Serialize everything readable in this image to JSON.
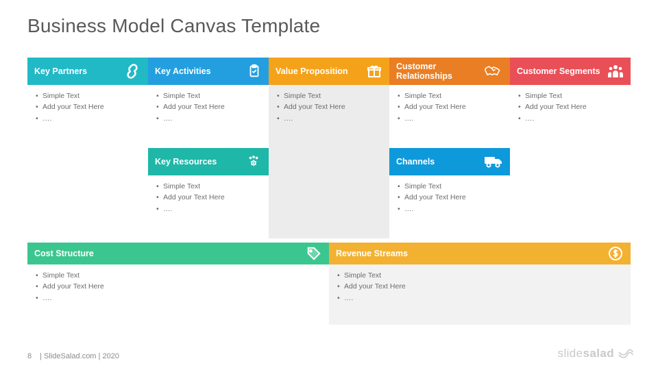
{
  "title": "Business Model Canvas Template",
  "blocks": {
    "keyPartners": {
      "label": "Key Partners",
      "color": "#22b9c6",
      "icon": "chain-icon",
      "bullets": [
        "Simple Text",
        "Add your Text Here",
        "…."
      ]
    },
    "keyActivities": {
      "label": "Key Activities",
      "color": "#239fe0",
      "icon": "clipboard-icon",
      "bullets": [
        "Simple Text",
        "Add your Text Here",
        "…."
      ]
    },
    "keyResources": {
      "label": "Key Resources",
      "color": "#1eb7a8",
      "icon": "people-gear-icon",
      "bullets": [
        "Simple Text",
        "Add your Text Here",
        "…."
      ]
    },
    "valueProp": {
      "label": "Value Proposition",
      "color": "#f5a21b",
      "icon": "gift-icon",
      "bullets": [
        "Simple Text",
        "Add your Text Here",
        "…."
      ]
    },
    "custRel": {
      "label": "Customer Relationships",
      "color": "#ea7e24",
      "icon": "handshake-icon",
      "bullets": [
        "Simple Text",
        "Add your Text Here",
        "…."
      ]
    },
    "channels": {
      "label": "Channels",
      "color": "#0e99db",
      "icon": "truck-icon",
      "bullets": [
        "Simple Text",
        "Add your Text Here",
        "…."
      ]
    },
    "custSeg": {
      "label": "Customer Segments",
      "color": "#e94f57",
      "icon": "people-icon",
      "bullets": [
        "Simple Text",
        "Add your Text Here",
        "…."
      ]
    },
    "costStruct": {
      "label": "Cost Structure",
      "color": "#3cc68f",
      "icon": "price-tag-icon",
      "bullets": [
        "Simple Text",
        "Add your Text Here",
        "…."
      ]
    },
    "revenue": {
      "label": "Revenue Streams",
      "color": "#f3b132",
      "icon": "dollar-circle-icon",
      "bullets": [
        "Simple Text",
        "Add your Text Here",
        "…."
      ]
    }
  },
  "footer": {
    "pageNumber": "8",
    "credit": "| SlideSalad.com | 2020"
  },
  "brand": {
    "part1": "slide",
    "part2": "salad"
  }
}
